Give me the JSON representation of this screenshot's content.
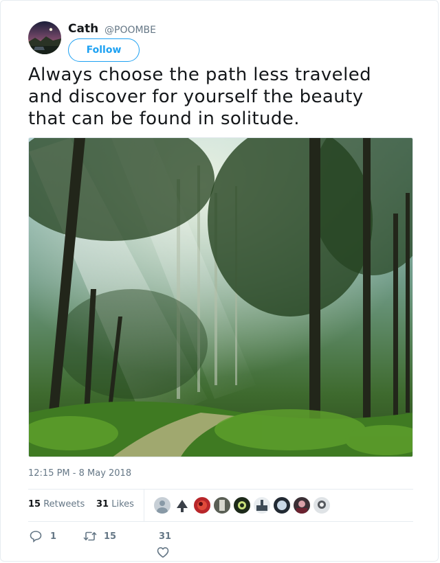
{
  "user": {
    "name": "Cath",
    "handle": "@POOMBE"
  },
  "follow_label": "Follow",
  "tweet": {
    "lines": [
      "Always choose the path less traveled",
      "and discover for yourself the beauty",
      "that can be found in solitude."
    ]
  },
  "photo": {
    "subject": "sunlit misty forest path"
  },
  "timestamp": "12:15 PM - 8 May 2018",
  "stats": {
    "retweets_count": "15",
    "retweets_label": "Retweets",
    "likes_count": "31",
    "likes_label": "Likes"
  },
  "actions": {
    "replies": "1",
    "retweets": "15",
    "likes": "31"
  },
  "colors": {
    "accent": "#1da1f2",
    "muted": "#657786",
    "text": "#14171a",
    "border": "#e6ecf0"
  },
  "icons": [
    "reply-icon",
    "retweet-icon",
    "heart-icon"
  ]
}
